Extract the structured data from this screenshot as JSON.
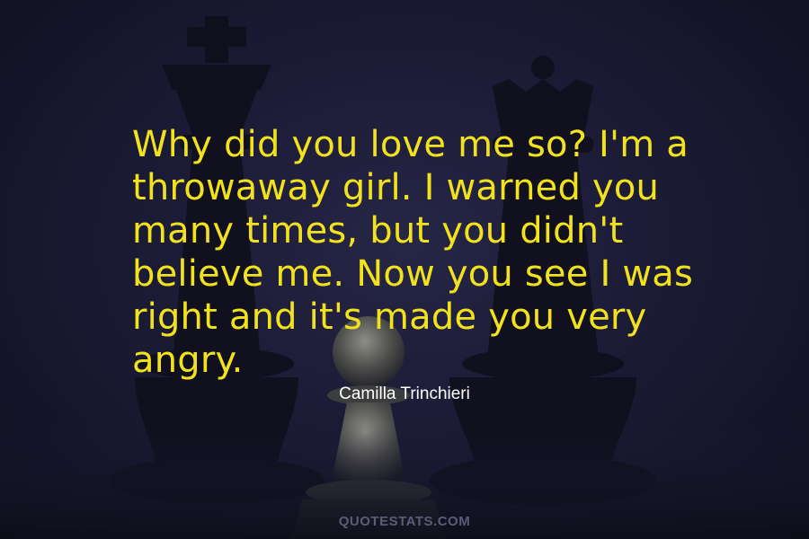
{
  "quote": {
    "lines": [
      "Why did you love me so? I'm a",
      "throwaway girl. I warned you",
      "many times, but you didn't",
      "believe me. Now you see I was",
      "right and it's made you very",
      "angry."
    ]
  },
  "author": "Camilla Trinchieri",
  "watermark": "QUOTESTATS.COM",
  "colors": {
    "quote_text": "#f2e21e",
    "author_text": "#ffffff",
    "background": "#1b1b36",
    "watermark": "#5c5c78"
  },
  "background_image": {
    "subject": "chess-pieces-silhouette",
    "pieces": [
      "king-icon",
      "queen-icon",
      "pawn-icon"
    ]
  }
}
